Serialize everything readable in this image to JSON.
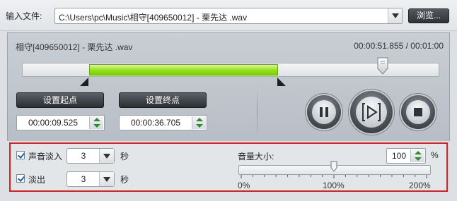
{
  "file_row": {
    "label": "输入文件:",
    "path": "C:\\Users\\pc\\Music\\相守[409650012] - 栗先达 .wav",
    "browse_label": "浏览..."
  },
  "player": {
    "track_name": "相守[409650012] - 栗先达 .wav",
    "time_display": "00:00:51.855 / 00:01:00",
    "duration_seconds": 60,
    "position_seconds": 51.855,
    "start_point": {
      "button_label": "设置起点",
      "value": "00:00:09.525",
      "seconds": 9.525
    },
    "end_point": {
      "button_label": "设置终点",
      "value": "00:00:36.705",
      "seconds": 36.705
    },
    "colors": {
      "selection": "#93e01c",
      "accent_border": "#e01c1c"
    },
    "controls": {
      "pause_icon": "pause-icon",
      "play_icon": "play-frame-icon",
      "stop_icon": "stop-icon"
    }
  },
  "fade": {
    "fade_in": {
      "label": "声音淡入",
      "checked": true,
      "value": "3",
      "unit": "秒"
    },
    "fade_out": {
      "label": "淡出",
      "checked": true,
      "value": "3",
      "unit": "秒"
    }
  },
  "volume": {
    "label": "音量大小:",
    "value": "100",
    "unit": "%",
    "level_fraction": 0.5,
    "scale": [
      "0%",
      "100%",
      "200%"
    ]
  }
}
